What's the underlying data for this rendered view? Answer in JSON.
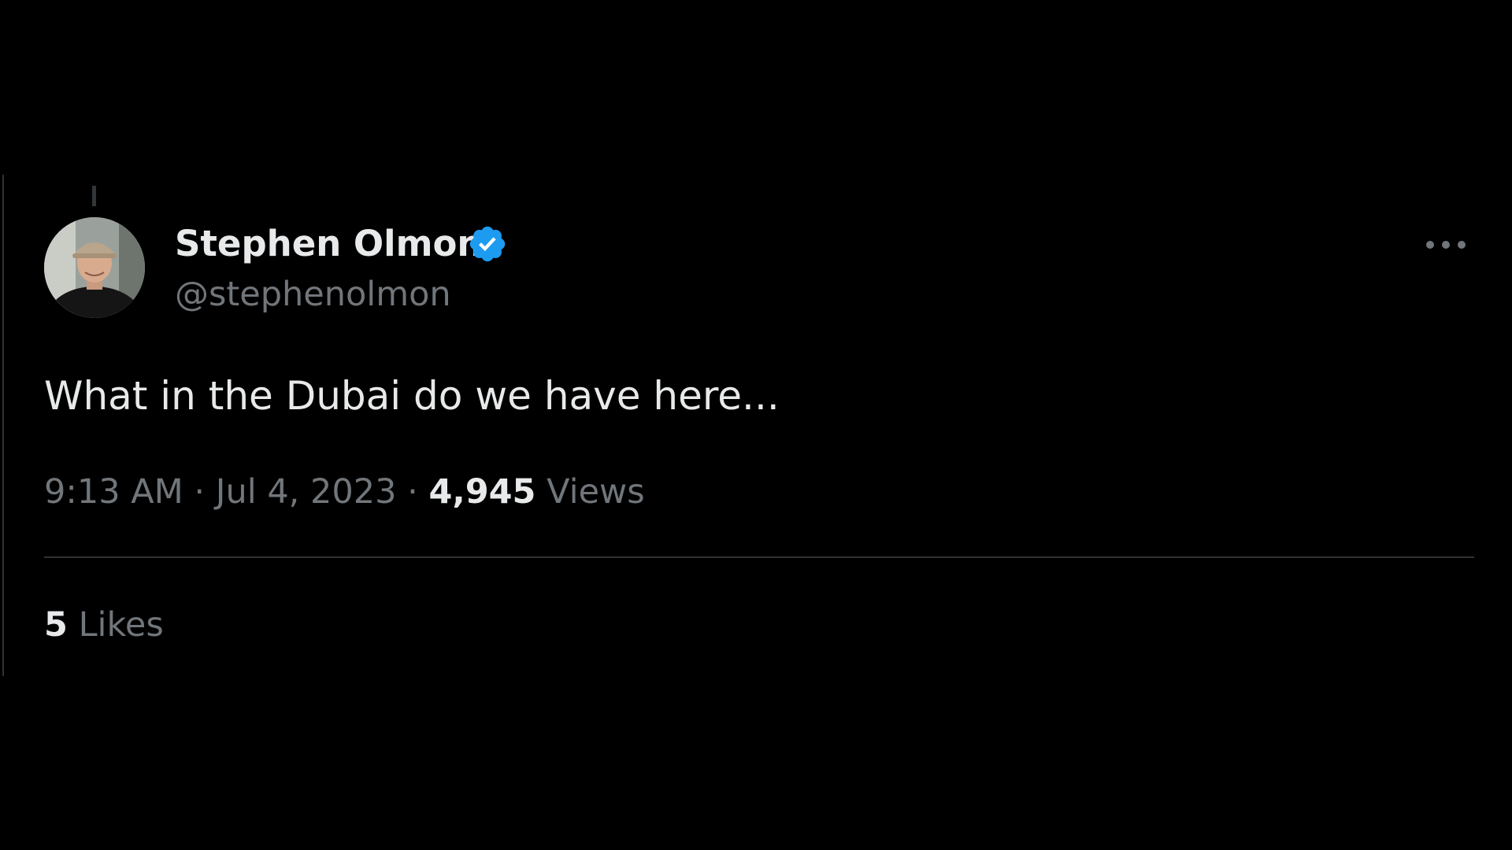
{
  "tweet": {
    "author": {
      "display_name": "Stephen Olmon",
      "handle": "@stephenolmon",
      "verified": true,
      "verified_color": "#1d9bf0"
    },
    "text": "What in the Dubai do we have here...",
    "time": "9:13 AM",
    "separator": "·",
    "date": "Jul 4, 2023",
    "views_count": "4,945",
    "views_label": "Views",
    "likes_count": "5",
    "likes_label": "Likes",
    "more_icon": "more-horizontal-icon"
  },
  "theme": {
    "background": "#000000",
    "primary_text": "#e7e9ea",
    "secondary_text": "#71767b",
    "divider": "#2f3336"
  }
}
